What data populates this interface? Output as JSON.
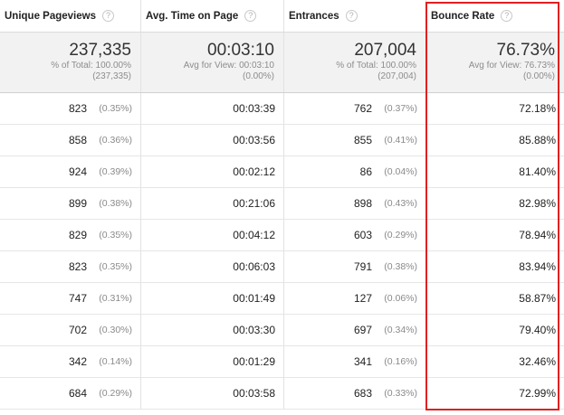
{
  "columns": [
    {
      "label": "Unique Pageviews"
    },
    {
      "label": "Avg. Time on Page"
    },
    {
      "label": "Entrances"
    },
    {
      "label": "Bounce Rate"
    }
  ],
  "help_icon": "?",
  "totals": [
    {
      "value": "237,335",
      "line1": "% of Total: 100.00%",
      "line2": "(237,335)"
    },
    {
      "value": "00:03:10",
      "line1": "Avg for View: 00:03:10",
      "line2": "(0.00%)"
    },
    {
      "value": "207,004",
      "line1": "% of Total: 100.00%",
      "line2": "(207,004)"
    },
    {
      "value": "76.73%",
      "line1": "Avg for View: 76.73%",
      "line2": "(0.00%)"
    }
  ],
  "rows": [
    {
      "pageviews": "823",
      "pageviews_pct": "(0.35%)",
      "avg_time": "00:03:39",
      "entrances": "762",
      "entrances_pct": "(0.37%)",
      "bounce_rate": "72.18%"
    },
    {
      "pageviews": "858",
      "pageviews_pct": "(0.36%)",
      "avg_time": "00:03:56",
      "entrances": "855",
      "entrances_pct": "(0.41%)",
      "bounce_rate": "85.88%"
    },
    {
      "pageviews": "924",
      "pageviews_pct": "(0.39%)",
      "avg_time": "00:02:12",
      "entrances": "86",
      "entrances_pct": "(0.04%)",
      "bounce_rate": "81.40%"
    },
    {
      "pageviews": "899",
      "pageviews_pct": "(0.38%)",
      "avg_time": "00:21:06",
      "entrances": "898",
      "entrances_pct": "(0.43%)",
      "bounce_rate": "82.98%"
    },
    {
      "pageviews": "829",
      "pageviews_pct": "(0.35%)",
      "avg_time": "00:04:12",
      "entrances": "603",
      "entrances_pct": "(0.29%)",
      "bounce_rate": "78.94%"
    },
    {
      "pageviews": "823",
      "pageviews_pct": "(0.35%)",
      "avg_time": "00:06:03",
      "entrances": "791",
      "entrances_pct": "(0.38%)",
      "bounce_rate": "83.94%"
    },
    {
      "pageviews": "747",
      "pageviews_pct": "(0.31%)",
      "avg_time": "00:01:49",
      "entrances": "127",
      "entrances_pct": "(0.06%)",
      "bounce_rate": "58.87%"
    },
    {
      "pageviews": "702",
      "pageviews_pct": "(0.30%)",
      "avg_time": "00:03:30",
      "entrances": "697",
      "entrances_pct": "(0.34%)",
      "bounce_rate": "79.40%"
    },
    {
      "pageviews": "342",
      "pageviews_pct": "(0.14%)",
      "avg_time": "00:01:29",
      "entrances": "341",
      "entrances_pct": "(0.16%)",
      "bounce_rate": "32.46%"
    },
    {
      "pageviews": "684",
      "pageviews_pct": "(0.29%)",
      "avg_time": "00:03:58",
      "entrances": "683",
      "entrances_pct": "(0.33%)",
      "bounce_rate": "72.99%"
    }
  ],
  "highlight": {
    "column": "Bounce Rate",
    "color": "#e02020"
  }
}
